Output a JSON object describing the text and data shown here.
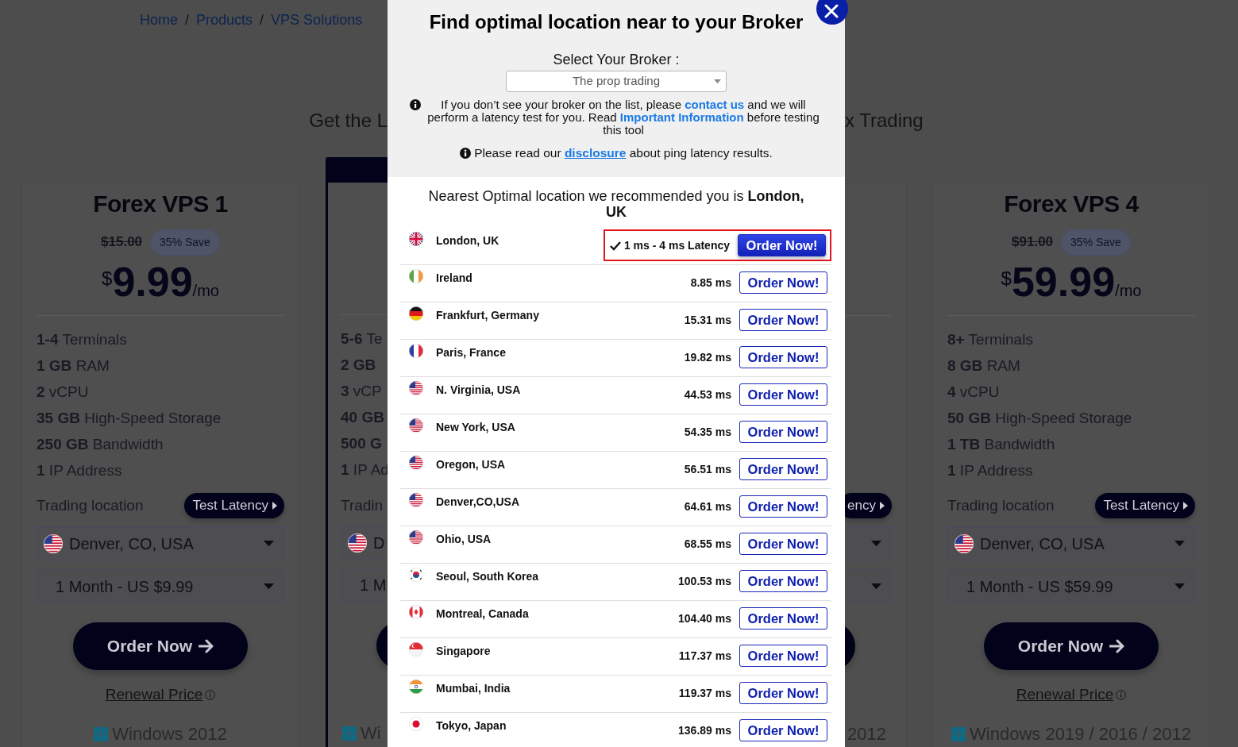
{
  "breadcrumb": {
    "separator": "/",
    "items": [
      {
        "label": "Home"
      },
      {
        "label": "Products"
      },
      {
        "label": "VPS Solutions"
      }
    ]
  },
  "heading_left": "Get the L",
  "heading_right": "x Trading",
  "plans": [
    {
      "kind": "full",
      "featured": false,
      "title": "Forex VPS 1",
      "old_price": "$15.00",
      "save_badge": "35% Save",
      "price_currency": "$",
      "price": "9.99",
      "price_unit": "/mo",
      "features": [
        "**1-4** Terminals",
        "**1 GB** RAM",
        "**2** vCPU",
        "**35 GB** High-Speed Storage",
        "**250 GB** Bandwidth",
        "**1** IP Address"
      ],
      "location_label": "Trading location",
      "test_button": "Test Latency",
      "location_select": {
        "value": "Denver, CO, USA",
        "kind": "usa",
        "caret": true
      },
      "plan_select": {
        "value": "1 Month - US $9.99",
        "caret": true
      },
      "order_button": {
        "label": "Order Now",
        "kind": "arrow"
      },
      "renewal_link": "Renewal Price",
      "os_text": "Windows 2012"
    },
    {
      "kind": "left-part",
      "featured": true,
      "features": [
        "**5-6** Te",
        "**2 GB**",
        "**3** vCP",
        "**40 GB**",
        "**500 G**",
        "**1** IP Ad"
      ],
      "location_label": "Tradin",
      "location_select": {
        "value": "D",
        "kind": "usa"
      },
      "plan_select": {
        "value": "1 M"
      },
      "order_button": {
        "kind": "blank"
      },
      "os_text": "Wi"
    },
    {
      "kind": "right-part",
      "featured": false,
      "test_button": "ency",
      "location_select": {
        "caret": true
      },
      "plan_select": {
        "caret": true
      },
      "order_button": {
        "kind": "blank"
      },
      "os_text": "2012"
    },
    {
      "kind": "full",
      "featured": false,
      "title": "Forex VPS 4",
      "old_price": "$91.00",
      "save_badge": "35% Save",
      "price_currency": "$",
      "price": "59.99",
      "price_unit": "/mo",
      "features": [
        "**8+** Terminals",
        "**8 GB** RAM",
        "**4** vCPU",
        "**50 GB** High-Speed Storage",
        "**1 TB** Bandwidth",
        "**1** IP Address"
      ],
      "location_label": "Trading location",
      "test_button": "Test Latency",
      "location_select": {
        "value": "Denver, CO, USA",
        "kind": "usa",
        "caret": true
      },
      "plan_select": {
        "value": "1 Month - US $59.99",
        "caret": true
      },
      "order_button": {
        "label": "Order Now",
        "kind": "arrow"
      },
      "renewal_link": "Renewal Price",
      "os_text": "Windows 2019 / 2016 / 2012"
    }
  ],
  "modal": {
    "title": "Find optimal location near to your Broker",
    "broker_label": "Select Your Broker :",
    "broker_select": {
      "value": "The prop trading"
    },
    "notes": [
      [
        {
          "text": "If you don’t see your broker on the list, please "
        },
        {
          "text": "contact us",
          "kind": "link"
        },
        {
          "text": " and we will perform a latency test for you. Read "
        },
        {
          "text": "Important Information",
          "kind": "link"
        },
        {
          "text": " before testing this tool"
        }
      ],
      [
        {
          "text": "Please read our "
        },
        {
          "text": "disclosure",
          "kind": "underlined-link"
        },
        {
          "text": " about ping latency results."
        }
      ]
    ],
    "recommendation": "Nearest Optimal location we recommended you is **London, UK**",
    "locations": [
      {
        "name": "London, UK",
        "kind": "uk",
        "latency": "1 ms - 4 ms Latency",
        "button": "Order Now!",
        "recommended": true
      },
      {
        "name": "Ireland",
        "kind": "ireland",
        "latency": "8.85 ms",
        "button": "Order Now!",
        "recommended": false
      },
      {
        "name": "Frankfurt, Germany",
        "kind": "germany",
        "latency": "15.31 ms",
        "button": "Order Now!",
        "recommended": false
      },
      {
        "name": "Paris, France",
        "kind": "france",
        "latency": "19.82 ms",
        "button": "Order Now!",
        "recommended": false
      },
      {
        "name": "N. Virginia, USA",
        "kind": "usa",
        "latency": "44.53 ms",
        "button": "Order Now!",
        "recommended": false
      },
      {
        "name": "New York, USA",
        "kind": "usa",
        "latency": "54.35 ms",
        "button": "Order Now!",
        "recommended": false
      },
      {
        "name": "Oregon, USA",
        "kind": "usa",
        "latency": "56.51 ms",
        "button": "Order Now!",
        "recommended": false
      },
      {
        "name": "Denver,CO,USA",
        "kind": "usa",
        "latency": "64.61 ms",
        "button": "Order Now!",
        "recommended": false
      },
      {
        "name": "Ohio, USA",
        "kind": "usa",
        "latency": "68.55 ms",
        "button": "Order Now!",
        "recommended": false
      },
      {
        "name": "Seoul, South Korea",
        "kind": "korea",
        "latency": "100.53 ms",
        "button": "Order Now!",
        "recommended": false
      },
      {
        "name": "Montreal, Canada",
        "kind": "canada",
        "latency": "104.40 ms",
        "button": "Order Now!",
        "recommended": false
      },
      {
        "name": "Singapore",
        "kind": "singapore",
        "latency": "117.37 ms",
        "button": "Order Now!",
        "recommended": false
      },
      {
        "name": "Mumbai, India",
        "kind": "india",
        "latency": "119.37 ms",
        "button": "Order Now!",
        "recommended": false
      },
      {
        "name": "Tokyo, Japan",
        "kind": "japan",
        "latency": "136.89 ms",
        "button": "Order Now!",
        "recommended": false
      }
    ]
  }
}
